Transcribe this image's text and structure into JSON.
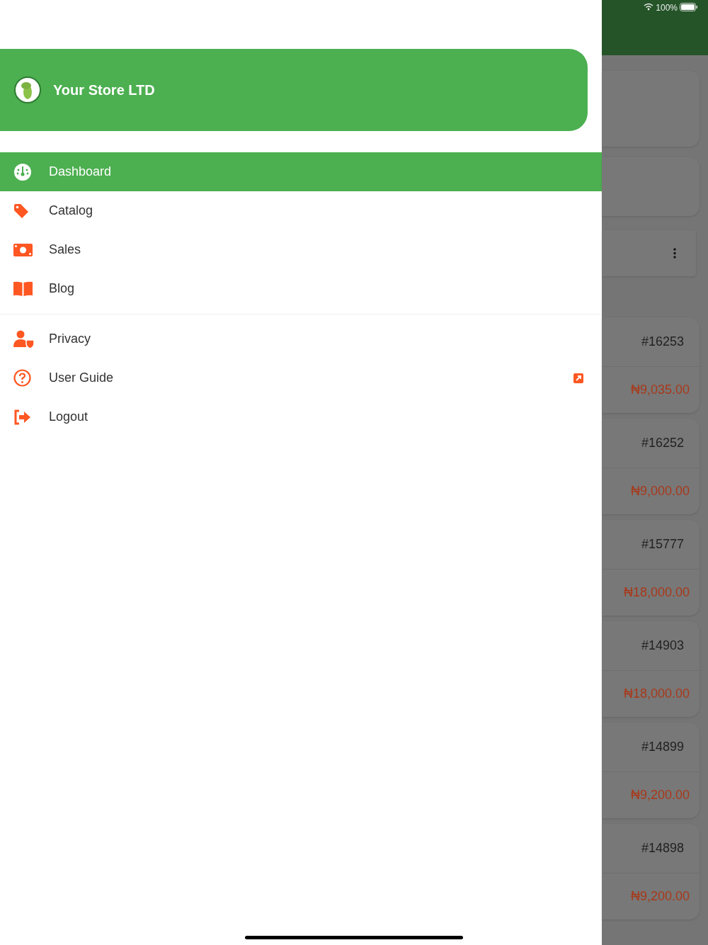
{
  "status_bar": {
    "battery": "100%"
  },
  "drawer": {
    "store_name": "Your Store LTD",
    "menu": [
      {
        "label": "Dashboard",
        "kind": "gauge",
        "selected": true,
        "external": false
      },
      {
        "label": "Catalog",
        "kind": "tag",
        "selected": false,
        "external": false
      },
      {
        "label": "Sales",
        "kind": "money",
        "selected": false,
        "external": false
      },
      {
        "label": "Blog",
        "kind": "book",
        "selected": false,
        "external": false
      }
    ],
    "secondary_menu": [
      {
        "label": "Privacy",
        "kind": "privacy",
        "selected": false,
        "external": false
      },
      {
        "label": "User Guide",
        "kind": "help",
        "selected": false,
        "external": true
      },
      {
        "label": "Logout",
        "kind": "logout",
        "selected": false,
        "external": false
      }
    ]
  },
  "orders": [
    {
      "number": "#16253",
      "amount": "₦9,035.00"
    },
    {
      "number": "#16252",
      "amount": "₦9,000.00"
    },
    {
      "number": "#15777",
      "amount": "₦18,000.00"
    },
    {
      "number": "#14903",
      "amount": "₦18,000.00"
    },
    {
      "number": "#14899",
      "amount": "₦9,200.00"
    },
    {
      "number": "#14898",
      "amount": "₦9,200.00"
    }
  ]
}
